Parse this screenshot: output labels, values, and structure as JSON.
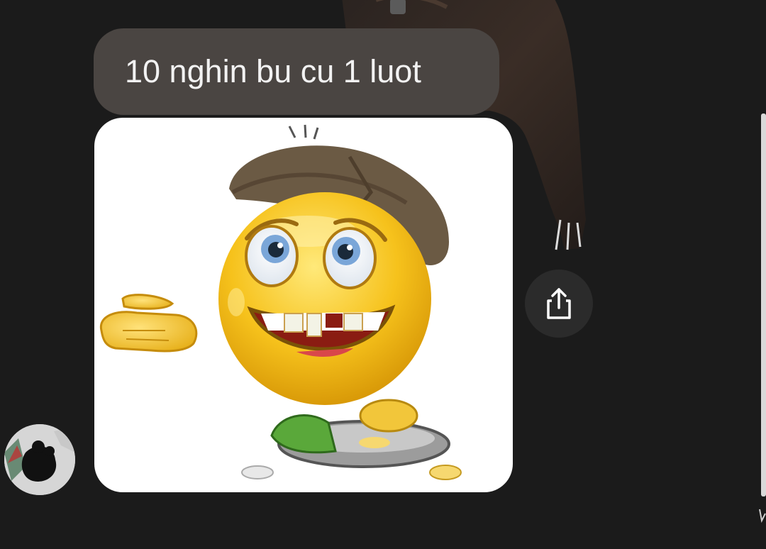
{
  "message": {
    "text": "10 nghin bu cu 1 luot"
  },
  "sticker": {
    "icon": "begging-emoji-sticker-icon"
  },
  "actions": {
    "share_icon": "share-icon"
  },
  "sender": {
    "avatar_icon": "avatar-icon"
  },
  "colors": {
    "background": "#1b1b1b",
    "bubble": "#4a4542",
    "bubble_text": "#f2f2f2",
    "share_button": "#2b2b2b"
  }
}
